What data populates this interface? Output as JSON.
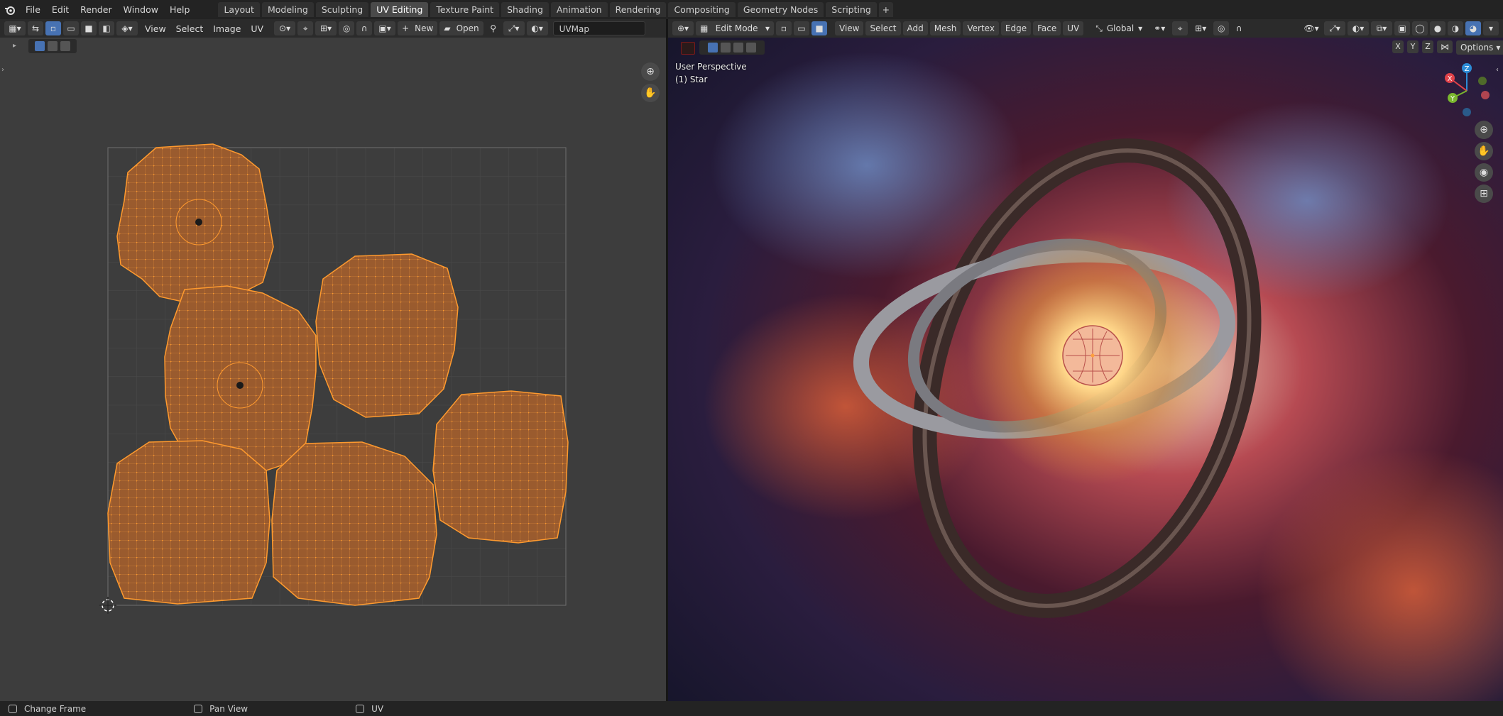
{
  "menu": {
    "file": "File",
    "edit": "Edit",
    "render": "Render",
    "window": "Window",
    "help": "Help"
  },
  "tabs": [
    {
      "label": "Layout"
    },
    {
      "label": "Modeling"
    },
    {
      "label": "Sculpting"
    },
    {
      "label": "UV Editing",
      "active": true
    },
    {
      "label": "Texture Paint"
    },
    {
      "label": "Shading"
    },
    {
      "label": "Animation"
    },
    {
      "label": "Rendering"
    },
    {
      "label": "Compositing"
    },
    {
      "label": "Geometry Nodes"
    },
    {
      "label": "Scripting"
    },
    {
      "label": "+"
    }
  ],
  "uv_header": {
    "view": "View",
    "select": "Select",
    "image": "Image",
    "uv": "UV",
    "new": "New",
    "open": "Open",
    "uvmap": "UVMap"
  },
  "vp_header": {
    "mode": "Edit Mode",
    "view": "View",
    "select": "Select",
    "add": "Add",
    "mesh": "Mesh",
    "vertex": "Vertex",
    "edge": "Edge",
    "face": "Face",
    "uv": "UV",
    "orientation": "Global",
    "x": "X",
    "y": "Y",
    "z": "Z",
    "options": "Options"
  },
  "viewport": {
    "perspective": "User Perspective",
    "object": "(1) Star"
  },
  "gizmo": {
    "x": "X",
    "y": "Y",
    "z": "Z"
  },
  "status": {
    "left": "Change Frame",
    "middle": "Pan View",
    "right": "UV"
  },
  "colors": {
    "accent": "#4772b3",
    "uv_island": "#9a5b2e",
    "uv_edge": "#ff9a2e"
  }
}
